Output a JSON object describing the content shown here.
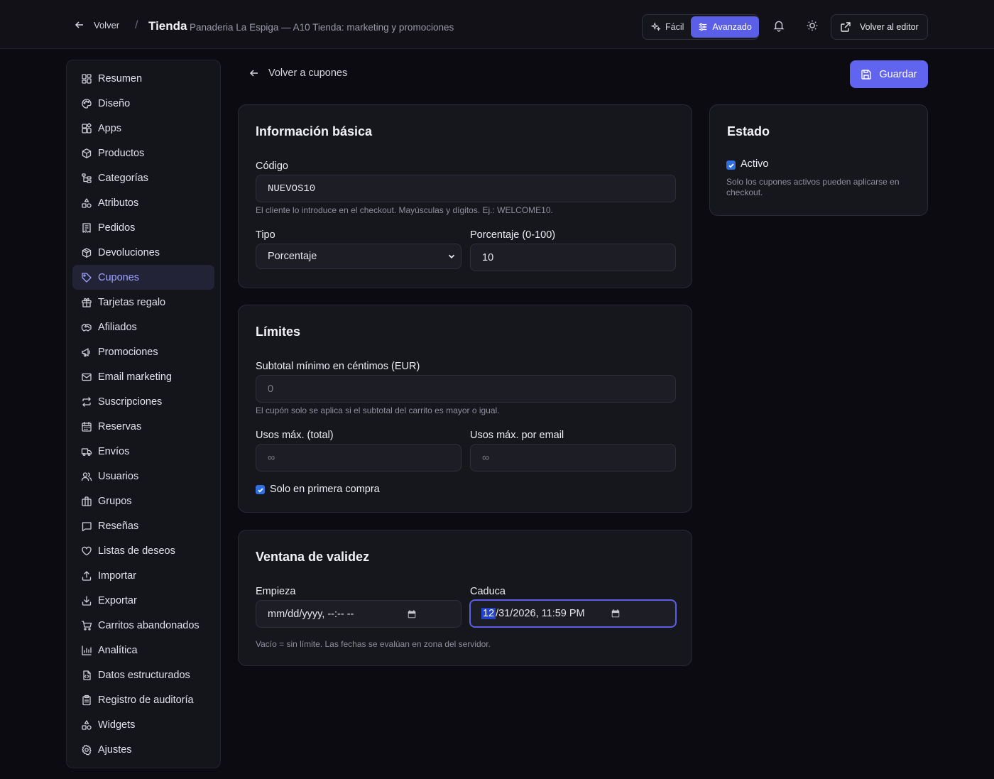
{
  "header": {
    "back_label": "Volver",
    "separator": "/",
    "title": "Tienda",
    "subtitle": "Panaderia La Espiga — A10 Tienda: marketing y promociones",
    "mode_easy": "Fácil",
    "mode_advanced": "Avanzado",
    "editor_button": "Volver al editor"
  },
  "sidebar": {
    "items": [
      {
        "label": "Resumen",
        "icon": "dashboard-icon"
      },
      {
        "label": "Diseño",
        "icon": "palette-icon"
      },
      {
        "label": "Apps",
        "icon": "apps-icon"
      },
      {
        "label": "Productos",
        "icon": "box-icon"
      },
      {
        "label": "Categorías",
        "icon": "tree-icon"
      },
      {
        "label": "Atributos",
        "icon": "shapes-icon"
      },
      {
        "label": "Pedidos",
        "icon": "receipt-icon"
      },
      {
        "label": "Devoluciones",
        "icon": "package-return-icon"
      },
      {
        "label": "Cupones",
        "icon": "tag-icon",
        "active": true
      },
      {
        "label": "Tarjetas regalo",
        "icon": "gift-icon"
      },
      {
        "label": "Afiliados",
        "icon": "handshake-icon"
      },
      {
        "label": "Promociones",
        "icon": "megaphone-icon"
      },
      {
        "label": "Email marketing",
        "icon": "mail-icon"
      },
      {
        "label": "Suscripciones",
        "icon": "repeat-icon"
      },
      {
        "label": "Reservas",
        "icon": "calendar-icon"
      },
      {
        "label": "Envíos",
        "icon": "truck-icon"
      },
      {
        "label": "Usuarios",
        "icon": "users-icon"
      },
      {
        "label": "Grupos",
        "icon": "group-icon"
      },
      {
        "label": "Reseñas",
        "icon": "comment-icon"
      },
      {
        "label": "Listas de deseos",
        "icon": "heart-icon"
      },
      {
        "label": "Importar",
        "icon": "upload-icon"
      },
      {
        "label": "Exportar",
        "icon": "download-icon"
      },
      {
        "label": "Carritos abandonados",
        "icon": "cart-icon"
      },
      {
        "label": "Analítica",
        "icon": "bar-chart-icon"
      },
      {
        "label": "Datos estructurados",
        "icon": "file-code-icon"
      },
      {
        "label": "Registro de auditoría",
        "icon": "clipboard-icon"
      },
      {
        "label": "Widgets",
        "icon": "widgets-icon"
      },
      {
        "label": "Ajustes",
        "icon": "gear-icon"
      }
    ]
  },
  "main": {
    "back_label": "Volver a cupones",
    "save_label": "Guardar",
    "basic": {
      "title": "Información básica",
      "code_label": "Código",
      "code_value": "NUEVOS10",
      "code_hint": "El cliente lo introduce en el checkout. Mayúsculas y dígitos. Ej.: WELCOME10.",
      "type_label": "Tipo",
      "type_value": "Porcentaje",
      "percent_label": "Porcentaje (0-100)",
      "percent_value": "10"
    },
    "limits": {
      "title": "Límites",
      "subtotal_label": "Subtotal mínimo en céntimos (EUR)",
      "subtotal_placeholder": "0",
      "subtotal_hint": "El cupón solo se aplica si el subtotal del carrito es mayor o igual.",
      "max_total_label": "Usos máx. (total)",
      "max_total_placeholder": "∞",
      "max_email_label": "Usos máx. por email",
      "max_email_placeholder": "∞",
      "first_purchase_label": "Solo en primera compra",
      "first_purchase_checked": true
    },
    "validity": {
      "title": "Ventana de validez",
      "start_label": "Empieza",
      "start_value": "mm/dd/yyyy, --:-- --",
      "end_label": "Caduca",
      "end_month": "12",
      "end_rest": "/31/2026, 11:59 PM",
      "hint": "Vacío = sin límite. Las fechas se evalúan en zona del servidor."
    },
    "status": {
      "title": "Estado",
      "active_label": "Activo",
      "active_checked": true,
      "hint": "Solo los cupones activos pueden aplicarse en checkout."
    }
  },
  "colors": {
    "accent": "#6064ee",
    "background": "#0b0b11",
    "card": "#16161d",
    "active_nav": "#9ea4ff"
  }
}
